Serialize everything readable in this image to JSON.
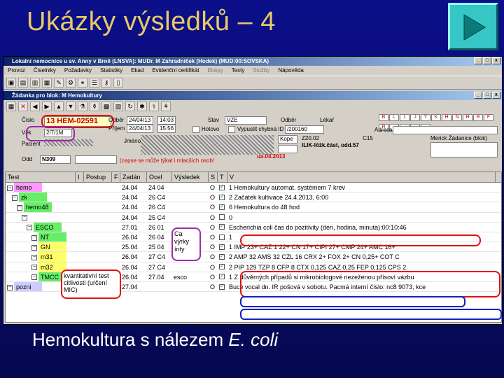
{
  "slide": {
    "title": "Ukázky výsledků – 4",
    "caption_prefix": "Hemokultura s nálezem ",
    "caption_species": "E. coli"
  },
  "app": {
    "window_title": "Lokalní nemocnice u sv. Anny v Brně (LNSVA): MUDr. M Zahradníček (Hodek) (MUD:00:SOVSKA)",
    "menu": [
      "Provoz",
      "Čiselniky",
      "Požadavky",
      "Statistiky",
      "Ekad",
      "Evidenční certifikát",
      "Eképy",
      "Texty",
      "Služby",
      "Nápověda"
    ],
    "menu_disabled": [
      false,
      false,
      false,
      false,
      false,
      false,
      true,
      false,
      true,
      false
    ],
    "subwindow_title": "Žádanka pro blok: M Hemokultury",
    "form": {
      "cislo_label": "Číslo",
      "cislo_value": "13 HEM-02591",
      "vek_label": "Věk",
      "vek_value": "2/7/1M",
      "prijem_label": "Příjem",
      "odber_label": "Odběr",
      "odber_date": "24/04/13",
      "odber_time": "14:03",
      "prijem_date": "24/04/13",
      "prijem_time": "15:56",
      "stav_label": "Stav",
      "stav_value": "VZE",
      "hotovo_label": "Hotovo",
      "vysledek_label": "Výsledek",
      "chybna_label": "Vypustit chybná ID",
      "sample_id": "/200160",
      "pacient_label": "Pacient",
      "jmeno_label": "Jméno",
      "odd_label": "Odd",
      "odd_value": "N309",
      "kope_button": "Kope",
      "adresa_label": "Adresa",
      "merick_label": "Merick Žádanice (blok)",
      "oddeleni_text": "ILIK-lôžk.část, odd.57",
      "code1": "Z20.02",
      "code2": "C15",
      "date_red": "ua.04.2013",
      "note_tick": "(cepse se může týkat i mlacších osob!",
      "flags_row1": [
        "B",
        "L",
        "1",
        "J",
        "Y",
        "K",
        "H",
        "N",
        "H",
        "R"
      ],
      "flags_row2": [
        "F",
        "R",
        "-",
        "-",
        "-",
        "-"
      ],
      "radio1": "Odběr",
      "radio2": "Lékař"
    },
    "grid": {
      "headers": [
        "Test",
        "I",
        "Postup",
        "F",
        "Zadán",
        "Ocel",
        "Výsledek",
        "S",
        "T",
        "V"
      ],
      "rows": [
        {
          "test": "hemo",
          "zad": "24.04",
          "oce": "24 04",
          "vys": "",
          "s": "O",
          "t": "✓",
          "v": "1  Hemokultury automat. systémem    7 krev",
          "color": "#ff99ff",
          "indent": 0
        },
        {
          "test": "zk",
          "zad": "24.04",
          "oce": "26 C4",
          "vys": "",
          "s": "O",
          "t": "✓",
          "v": "2  Začátek kultivace     24.4.2013, 6:00",
          "color": "#66ee66",
          "indent": 1
        },
        {
          "test": "hemo48",
          "zad": "24.04",
          "oce": "26 C4",
          "vys": "",
          "s": "O",
          "t": "✓",
          "v": "6  Hemokultura do 48 hod",
          "color": "#66ee66",
          "indent": 2
        },
        {
          "test": "",
          "zad": "24.04",
          "oce": "25 C4",
          "vys": "",
          "s": "O",
          "t": "",
          "v": "0",
          "color": "#66ee66",
          "indent": 3
        },
        {
          "test": "ESCO",
          "zad": "27.01",
          "oce": "26 01",
          "vys": "",
          "s": "O",
          "t": "✓",
          "v": "Escherichia coli     čas do pozitivity (den, hodina, minuta):00:10:46",
          "color": "#66ee66",
          "indent": 4
        },
        {
          "test": "NT",
          "zad": "26.04",
          "oce": "26 04",
          "vys": "",
          "s": "O",
          "t": "",
          "v": "1",
          "color": "#66ee66",
          "indent": 5
        },
        {
          "test": "GN",
          "zad": "25.04",
          "oce": "25 04",
          "vys": "",
          "s": "O",
          "t": "✓",
          "v": "1  IMP 23+  CAZ 1 22+  CN 17+  CIPI 27+  CMP 24+  AMC 16+",
          "color": "#ffff66",
          "indent": 5
        },
        {
          "test": "m31",
          "zad": "26.04",
          "oce": "27 C4",
          "vys": "",
          "s": "O",
          "t": "✓",
          "v": "2  AMP 32  AMS 32  CZL 16  CRX 2+  FOX 2+  CN 0,25+  COT C",
          "color": "#ffff66",
          "indent": 5
        },
        {
          "test": "m32",
          "zad": "26.04",
          "oce": "27 C4",
          "vys": "",
          "s": "O",
          "t": "✓",
          "v": "2  PIP 129  TZP 8  CFP 8  CTX 0,125  CAZ 0,25  FEP 0,125  CPS 2",
          "color": "#ffff66",
          "indent": 5
        },
        {
          "test": "TMCC",
          "zad": "26.04",
          "oce": "27.04",
          "vys": "esco",
          "s": "O",
          "t": "✓",
          "v": "1  Z důvěrných případů si mikrobiologové nezeženou přísoví vázbu",
          "color": "#66ee66",
          "indent": 5
        },
        {
          "test": "pozni",
          "zad": "27.04",
          "oce": "",
          "vys": "",
          "s": "O",
          "t": "✓",
          "v": "Buce vocal dn. IR pošová v sobotu. Pacmá interní číslo: nc8 9073, kce",
          "color": "#ccccff",
          "indent": 0
        }
      ]
    },
    "annotations": {
      "purple_note": "Ca výrky ínty",
      "red_note": "kvantitativní test citlivosti (určení MIC)"
    }
  }
}
